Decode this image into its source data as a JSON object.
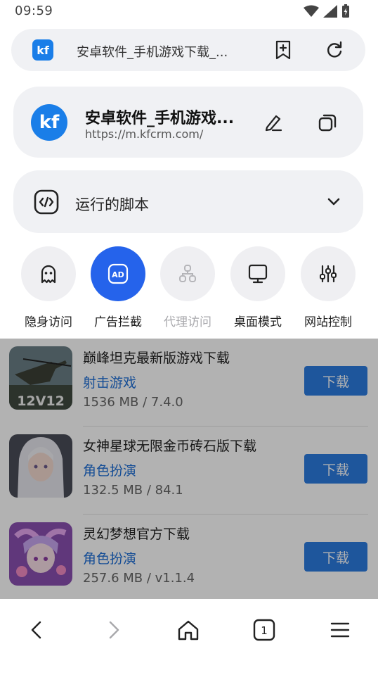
{
  "status": {
    "time": "09:59"
  },
  "urlbar": {
    "site_icon_text": "kf",
    "url_text": "安卓软件_手机游戏下载_..."
  },
  "site_info": {
    "logo_text": "kf",
    "title": "安卓软件_手机游戏...",
    "url": "https://m.kfcrm.com/"
  },
  "scripts": {
    "label": "运行的脚本"
  },
  "quick_actions": [
    {
      "label": "隐身访问",
      "icon": "ghost-icon",
      "active": false,
      "enabled": true
    },
    {
      "label": "广告拦截",
      "icon": "ad-block-icon",
      "active": true,
      "enabled": true
    },
    {
      "label": "代理访问",
      "icon": "proxy-icon",
      "active": false,
      "enabled": false
    },
    {
      "label": "桌面模式",
      "icon": "desktop-icon",
      "active": false,
      "enabled": true
    },
    {
      "label": "网站控制",
      "icon": "sliders-icon",
      "active": false,
      "enabled": true
    }
  ],
  "apps": [
    {
      "name": "巅峰坦克最新版游戏下载",
      "category": "射击游戏",
      "size": "1536 MB / 7.4.0",
      "download_label": "下载",
      "thumb_text": "12V12"
    },
    {
      "name": "女神星球无限金币砖石版下载",
      "category": "角色扮演",
      "size": "132.5 MB / 84.1",
      "download_label": "下载"
    },
    {
      "name": "灵幻梦想官方下载",
      "category": "角色扮演",
      "size": "257.6 MB / v1.1.4",
      "download_label": "下载"
    }
  ],
  "bottom_nav": {
    "tab_count": "1"
  },
  "colors": {
    "accent": "#2563eb",
    "download_button": "#2b7be0",
    "category_link": "#1f6fd6",
    "card_bg": "#f0f1f4"
  }
}
